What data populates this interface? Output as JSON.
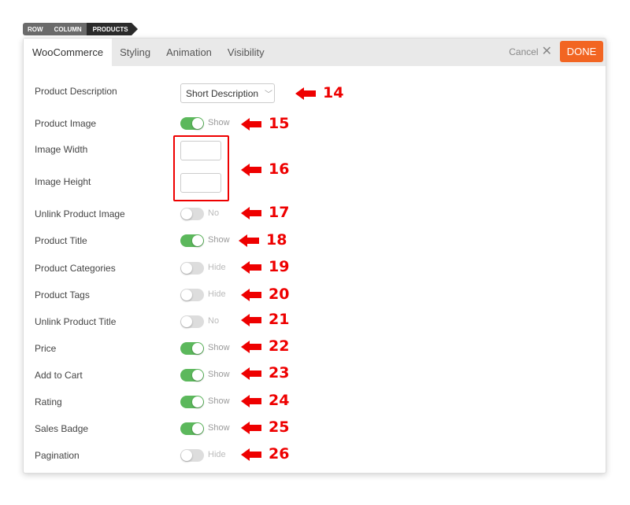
{
  "breadcrumb": [
    "ROW",
    "COLUMN",
    "PRODUCTS"
  ],
  "tabs": [
    "WooCommerce",
    "Styling",
    "Animation",
    "Visibility"
  ],
  "header": {
    "cancel_label": "Cancel",
    "done_label": "DONE",
    "accent": "#f26522"
  },
  "fields": [
    {
      "label": "Product Description",
      "type": "select",
      "value": "Short Description",
      "marker": "14"
    },
    {
      "label": "Product Image",
      "type": "toggle",
      "on": true,
      "value": "Show",
      "marker": "15"
    },
    {
      "label": "Image Width",
      "type": "input",
      "value": "",
      "marker": "16"
    },
    {
      "label": "Image Height",
      "type": "input",
      "value": ""
    },
    {
      "label": "Unlink Product Image",
      "type": "toggle",
      "on": false,
      "value": "No",
      "marker": "17"
    },
    {
      "label": "Product Title",
      "type": "toggle",
      "on": true,
      "value": "Show",
      "marker": "18"
    },
    {
      "label": "Product Categories",
      "type": "toggle",
      "on": false,
      "value": "Hide",
      "marker": "19"
    },
    {
      "label": "Product Tags",
      "type": "toggle",
      "on": false,
      "value": "Hide",
      "marker": "20"
    },
    {
      "label": "Unlink Product Title",
      "type": "toggle",
      "on": false,
      "value": "No",
      "marker": "21"
    },
    {
      "label": "Price",
      "type": "toggle",
      "on": true,
      "value": "Show",
      "marker": "22"
    },
    {
      "label": "Add to Cart",
      "type": "toggle",
      "on": true,
      "value": "Show",
      "marker": "23"
    },
    {
      "label": "Rating",
      "type": "toggle",
      "on": true,
      "value": "Show",
      "marker": "24"
    },
    {
      "label": "Sales Badge",
      "type": "toggle",
      "on": true,
      "value": "Show",
      "marker": "25"
    },
    {
      "label": "Pagination",
      "type": "toggle",
      "on": false,
      "value": "Hide",
      "marker": "26"
    }
  ]
}
